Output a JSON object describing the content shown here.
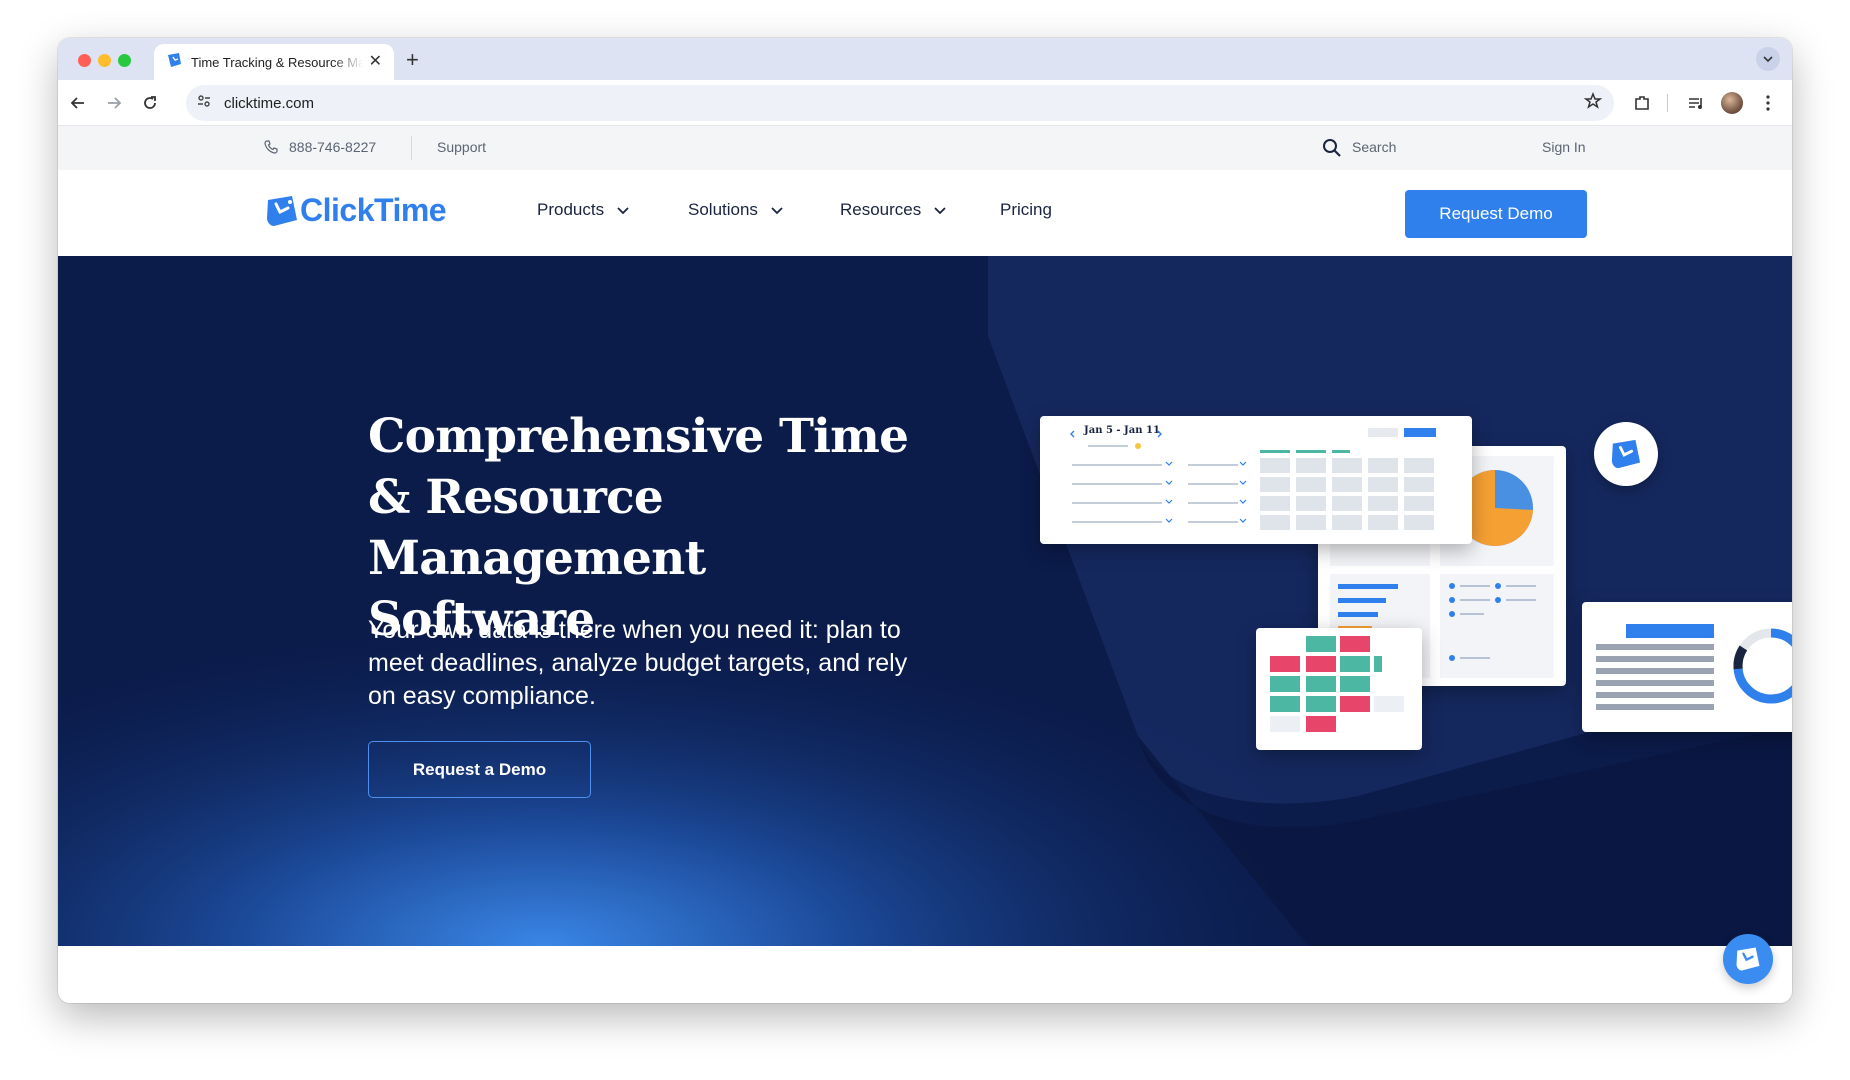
{
  "browser": {
    "tab_title": "Time Tracking & Resource Management Software",
    "url": "clicktime.com"
  },
  "utility_bar": {
    "phone": "888-746-8227",
    "support": "Support",
    "search_label": "Search",
    "sign_in": "Sign In"
  },
  "nav": {
    "logo_text": "ClickTime",
    "items": [
      {
        "label": "Products",
        "dropdown": true
      },
      {
        "label": "Solutions",
        "dropdown": true
      },
      {
        "label": "Resources",
        "dropdown": true
      },
      {
        "label": "Pricing",
        "dropdown": false
      }
    ],
    "cta": "Request Demo"
  },
  "hero": {
    "title": "Comprehensive Time & Resource Management Software",
    "subtitle": "Your own data is there when you need it: plan to meet deadlines, analyze budget targets, and rely on easy compliance.",
    "cta": "Request a Demo",
    "illustration": {
      "date_range": "Jan 5 - Jan 11"
    }
  },
  "colors": {
    "brand_blue": "#2f80ed",
    "hero_navy": "#0b1b4a",
    "teal": "#4cb8a4",
    "pink": "#e8456b",
    "orange": "#f5a033"
  }
}
